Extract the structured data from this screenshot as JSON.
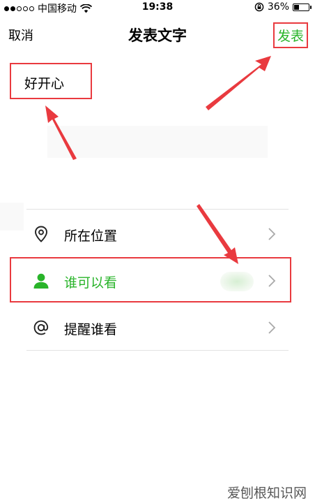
{
  "status_bar": {
    "carrier": "中国移动",
    "time": "19:38",
    "battery": "36%",
    "battery_level": 0.36
  },
  "nav": {
    "cancel_label": "取消",
    "title": "发表文字",
    "publish_label": "发表"
  },
  "post": {
    "text": "好开心"
  },
  "options": [
    {
      "label": "所在位置",
      "icon": "location-pin-icon"
    },
    {
      "label": "谁可以看",
      "icon": "person-icon"
    },
    {
      "label": "提醒谁看",
      "icon": "at-sign-icon"
    }
  ],
  "colors": {
    "accent": "#29b42a",
    "annotation": "#e93a3f"
  },
  "watermark": "爱刨根知识网"
}
